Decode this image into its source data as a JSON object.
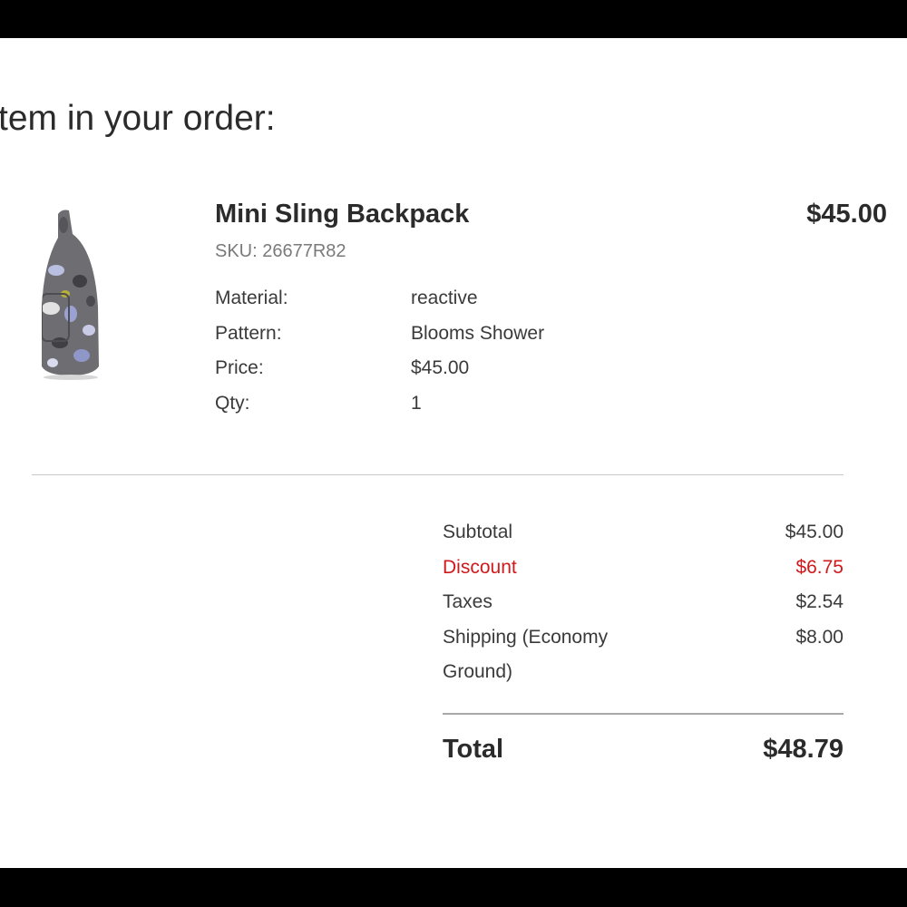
{
  "heading": "tem in your order:",
  "item": {
    "image_alt": "Mini Sling Backpack product image",
    "name": "Mini Sling Backpack",
    "price": "$45.00",
    "sku": "SKU: 26677R82",
    "attributes": [
      {
        "label": "Material:",
        "value": "reactive"
      },
      {
        "label": "Pattern:",
        "value": "Blooms Shower"
      },
      {
        "label": "Price:",
        "value": "$45.00"
      },
      {
        "label": "Qty:",
        "value": "1"
      }
    ]
  },
  "summary": {
    "subtotal_label": "Subtotal",
    "subtotal_value": "$45.00",
    "discount_label": "Discount",
    "discount_value": "$6.75",
    "taxes_label": "Taxes",
    "taxes_value": "$2.54",
    "shipping_label": "Shipping (Economy Ground)",
    "shipping_value": "$8.00",
    "total_label": "Total",
    "total_value": "$48.79"
  },
  "colors": {
    "text": "#2b2b2b",
    "muted": "#7a7a7a",
    "discount": "#d0191c",
    "bag_body": "#6e6e72"
  }
}
